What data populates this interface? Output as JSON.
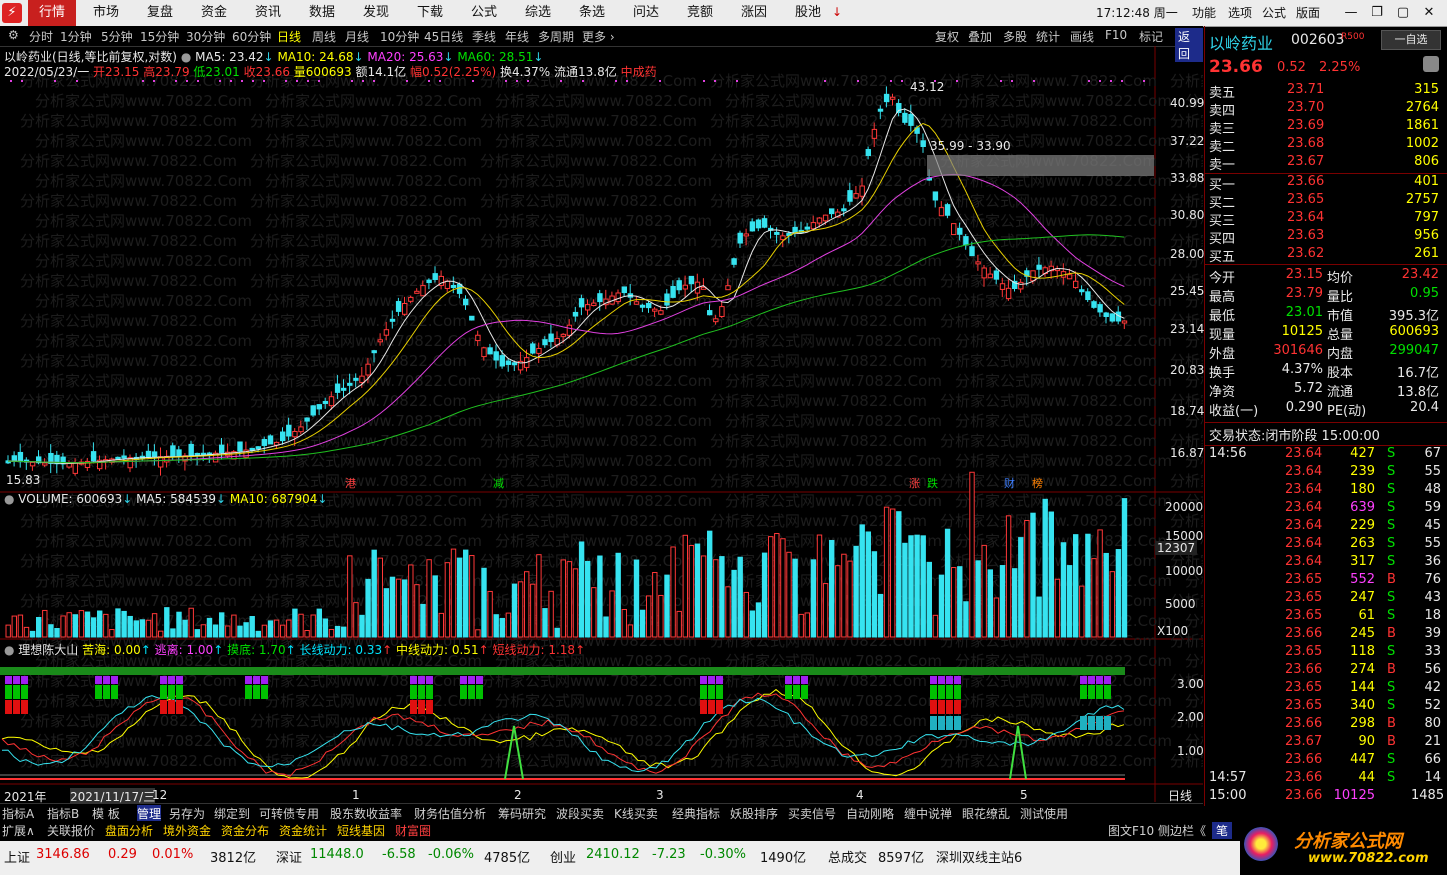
{
  "menu": {
    "items": [
      "行情",
      "市场",
      "复盘",
      "资金",
      "资讯",
      "数据",
      "发现",
      "下载",
      "公式",
      "综选",
      "条选",
      "问达",
      "竞额",
      "涨因",
      "股池"
    ],
    "active_index": 0,
    "clock": "17:12:48 周一",
    "right_items": [
      "功能",
      "选项",
      "公式",
      "版面"
    ]
  },
  "periods": {
    "items": [
      "分时",
      "1分钟",
      "5分钟",
      "15分钟",
      "30分钟",
      "60分钟",
      "日线",
      "周线",
      "月线",
      "10分钟",
      "45日线",
      "季线",
      "年线",
      "多周期",
      "更多 ›"
    ],
    "selected_index": 6
  },
  "chart_tools": [
    "复权",
    "叠加",
    "多股",
    "统计",
    "画线",
    "F10",
    "标记",
    "返回"
  ],
  "header": {
    "title": "以岭药业(日线,等比前复权,对数)",
    "ma5": "MA5: 23.42",
    "ma10": "MA10: 24.68",
    "ma20": "MA20: 25.63",
    "ma60": "MA60: 28.51",
    "date": "2022/05/23/一",
    "open": "开23.15",
    "high": "高23.79",
    "low": "低23.01",
    "close": "收23.66",
    "vol": "量600693",
    "amount": "额14.1亿",
    "change": "幅0.52(2.25%)",
    "turnover": "换4.37%",
    "float": "流通13.8亿",
    "concept": "中成药"
  },
  "price_axis": [
    "40.99",
    "37.22",
    "33.88",
    "30.80",
    "28.00",
    "25.45",
    "23.14",
    "20.83",
    "18.74",
    "16.87"
  ],
  "annotations": {
    "high_label": "43.12",
    "low_label": "15.83",
    "gap_label": "35.99 - 33.90",
    "markers": [
      "港",
      "减",
      "涨",
      "跌",
      "财",
      "榜"
    ]
  },
  "volume": {
    "title": "VOLUME: 600693",
    "ma5": "MA5: 584539",
    "ma10": "MA10: 687904",
    "axis": [
      "20000",
      "15000",
      "10000",
      "5000"
    ],
    "current": "12307",
    "unit": "X100"
  },
  "indicator": {
    "name": "理想陈大山",
    "items": [
      {
        "label": "苦海: 0.00",
        "color": "#ffff00"
      },
      {
        "label": "逃离: 1.00",
        "color": "#ff40ff"
      },
      {
        "label": "摸底: 1.70",
        "color": "#00e000"
      },
      {
        "label": "长线动力: 0.33",
        "color": "#00e5ff"
      },
      {
        "label": "中线动力: 0.51",
        "color": "#ffff00"
      },
      {
        "label": "短线动力: 1.18",
        "color": "#ff3333"
      }
    ],
    "axis": [
      "3.00",
      "2.00",
      "1.00"
    ]
  },
  "time_axis": [
    "2021年",
    "2021/11/17/三",
    "12",
    "1",
    "2",
    "3",
    "4",
    "5"
  ],
  "period_label": "日线",
  "stock": {
    "name": "以岭药业",
    "code": "002603",
    "tag": "R500",
    "watch_button": "一自选",
    "price": "23.66",
    "change": "0.52",
    "pct": "2.25%"
  },
  "orderbook": {
    "asks": [
      {
        "label": "卖五",
        "price": "23.71",
        "vol": "315"
      },
      {
        "label": "卖四",
        "price": "23.70",
        "vol": "2764"
      },
      {
        "label": "卖三",
        "price": "23.69",
        "vol": "1861"
      },
      {
        "label": "卖二",
        "price": "23.68",
        "vol": "1002"
      },
      {
        "label": "卖一",
        "price": "23.67",
        "vol": "806"
      }
    ],
    "bids": [
      {
        "label": "买一",
        "price": "23.66",
        "vol": "401"
      },
      {
        "label": "买二",
        "price": "23.65",
        "vol": "2757"
      },
      {
        "label": "买三",
        "price": "23.64",
        "vol": "797"
      },
      {
        "label": "买四",
        "price": "23.63",
        "vol": "956"
      },
      {
        "label": "买五",
        "price": "23.62",
        "vol": "261"
      }
    ]
  },
  "stats": [
    {
      "l1": "今开",
      "v1": "23.15",
      "c1": "red",
      "l2": "均价",
      "v2": "23.42",
      "c2": "red"
    },
    {
      "l1": "最高",
      "v1": "23.79",
      "c1": "red",
      "l2": "量比",
      "v2": "0.95",
      "c2": "grn"
    },
    {
      "l1": "最低",
      "v1": "23.01",
      "c1": "grn",
      "l2": "市值",
      "v2": "395.3亿",
      "c2": "wht"
    },
    {
      "l1": "现量",
      "v1": "10125",
      "c1": "yel",
      "l2": "总量",
      "v2": "600693",
      "c2": "yel"
    },
    {
      "l1": "外盘",
      "v1": "301646",
      "c1": "red",
      "l2": "内盘",
      "v2": "299047",
      "c2": "grn"
    },
    {
      "l1": "换手",
      "v1": "4.37%",
      "c1": "wht",
      "l2": "股本",
      "v2": "16.7亿",
      "c2": "wht"
    },
    {
      "l1": "净资",
      "v1": "5.72",
      "c1": "wht",
      "l2": "流通",
      "v2": "13.8亿",
      "c2": "wht"
    },
    {
      "l1": "收益(一)",
      "v1": "0.290",
      "c1": "wht",
      "l2": "PE(动)",
      "v2": "20.4",
      "c2": "wht"
    }
  ],
  "trade_status": {
    "label": "交易状态:",
    "value": "闭市阶段",
    "time": "15:00:00"
  },
  "ticks": [
    {
      "t": "14:56",
      "p": "23.64",
      "v": "427",
      "bs": "S",
      "n": "67"
    },
    {
      "t": "",
      "p": "23.64",
      "v": "239",
      "bs": "S",
      "n": "55"
    },
    {
      "t": "",
      "p": "23.64",
      "v": "180",
      "bs": "S",
      "n": "48"
    },
    {
      "t": "",
      "p": "23.64",
      "v": "639",
      "bs": "S",
      "n": "59"
    },
    {
      "t": "",
      "p": "23.64",
      "v": "229",
      "bs": "S",
      "n": "45"
    },
    {
      "t": "",
      "p": "23.64",
      "v": "263",
      "bs": "S",
      "n": "55"
    },
    {
      "t": "",
      "p": "23.64",
      "v": "317",
      "bs": "S",
      "n": "36"
    },
    {
      "t": "",
      "p": "23.65",
      "v": "552",
      "bs": "B",
      "n": "76"
    },
    {
      "t": "",
      "p": "23.65",
      "v": "247",
      "bs": "S",
      "n": "43"
    },
    {
      "t": "",
      "p": "23.65",
      "v": "61",
      "bs": "S",
      "n": "18"
    },
    {
      "t": "",
      "p": "23.66",
      "v": "245",
      "bs": "B",
      "n": "39"
    },
    {
      "t": "",
      "p": "23.65",
      "v": "118",
      "bs": "S",
      "n": "33"
    },
    {
      "t": "",
      "p": "23.66",
      "v": "274",
      "bs": "B",
      "n": "56"
    },
    {
      "t": "",
      "p": "23.65",
      "v": "144",
      "bs": "S",
      "n": "42"
    },
    {
      "t": "",
      "p": "23.65",
      "v": "340",
      "bs": "S",
      "n": "52"
    },
    {
      "t": "",
      "p": "23.66",
      "v": "298",
      "bs": "B",
      "n": "80"
    },
    {
      "t": "",
      "p": "23.67",
      "v": "90",
      "bs": "B",
      "n": "21"
    },
    {
      "t": "",
      "p": "23.66",
      "v": "447",
      "bs": "S",
      "n": "66"
    },
    {
      "t": "14:57",
      "p": "23.66",
      "v": "44",
      "bs": "S",
      "n": "14"
    },
    {
      "t": "15:00",
      "p": "23.66",
      "v": "10125",
      "bs": "",
      "n": "1485"
    }
  ],
  "bottom_tabs1": [
    "指标A",
    "指标B",
    "模 板",
    "管理",
    "另存为",
    "绑定到",
    "可转债专用",
    "股东数收益率",
    "财务估值分析",
    "筹码研究",
    "波段买卖",
    "K线买卖",
    "经典指标",
    "妖股排序",
    "买卖信号",
    "自动刚略",
    "缠中说禅",
    "眼花缭乱",
    "测试使用"
  ],
  "bottom_tabs2": [
    "扩展∧",
    "关联报价",
    "盘面分析",
    "境外资金",
    "资金分布",
    "资金统计",
    "短线基因",
    "财富圈"
  ],
  "bottom_right": "图文F10 侧边栏《",
  "bottom_pen": "笔",
  "statusbar": {
    "sh_label": "上证",
    "sh_val": "3146.86",
    "sh_chg": "0.29",
    "sh_pct": "0.01%",
    "sh_amt": "3812亿",
    "sz_label": "深证",
    "sz_val": "11448.0",
    "sz_chg": "-6.58",
    "sz_pct": "-0.06%",
    "sz_amt": "4785亿",
    "cy_label": "创业",
    "cy_val": "2410.12",
    "cy_chg": "-7.23",
    "cy_pct": "-0.30%",
    "cy_amt": "1490亿",
    "total_label": "总成交",
    "total_amt": "8597亿",
    "server": "深圳双线主站6"
  },
  "brand": {
    "text": "分析家公式网",
    "url": "www.70822.com"
  },
  "watermark": "分析家公式网www.70822.Com"
}
